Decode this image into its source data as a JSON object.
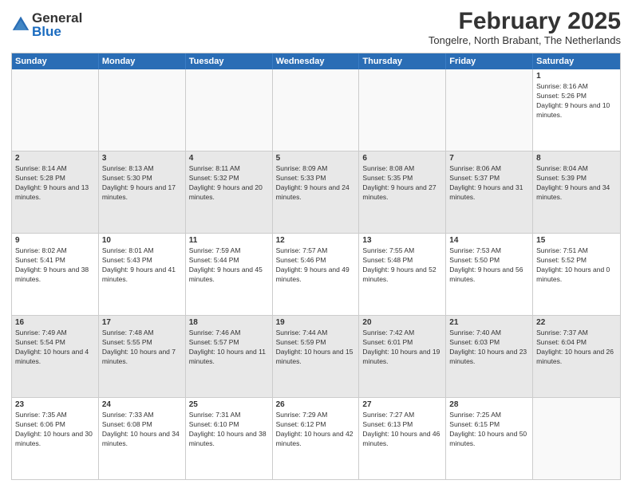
{
  "logo": {
    "general": "General",
    "blue": "Blue"
  },
  "title": "February 2025",
  "location": "Tongelre, North Brabant, The Netherlands",
  "header_days": [
    "Sunday",
    "Monday",
    "Tuesday",
    "Wednesday",
    "Thursday",
    "Friday",
    "Saturday"
  ],
  "weeks": [
    [
      {
        "day": "",
        "info": ""
      },
      {
        "day": "",
        "info": ""
      },
      {
        "day": "",
        "info": ""
      },
      {
        "day": "",
        "info": ""
      },
      {
        "day": "",
        "info": ""
      },
      {
        "day": "",
        "info": ""
      },
      {
        "day": "1",
        "info": "Sunrise: 8:16 AM\nSunset: 5:26 PM\nDaylight: 9 hours and 10 minutes."
      }
    ],
    [
      {
        "day": "2",
        "info": "Sunrise: 8:14 AM\nSunset: 5:28 PM\nDaylight: 9 hours and 13 minutes."
      },
      {
        "day": "3",
        "info": "Sunrise: 8:13 AM\nSunset: 5:30 PM\nDaylight: 9 hours and 17 minutes."
      },
      {
        "day": "4",
        "info": "Sunrise: 8:11 AM\nSunset: 5:32 PM\nDaylight: 9 hours and 20 minutes."
      },
      {
        "day": "5",
        "info": "Sunrise: 8:09 AM\nSunset: 5:33 PM\nDaylight: 9 hours and 24 minutes."
      },
      {
        "day": "6",
        "info": "Sunrise: 8:08 AM\nSunset: 5:35 PM\nDaylight: 9 hours and 27 minutes."
      },
      {
        "day": "7",
        "info": "Sunrise: 8:06 AM\nSunset: 5:37 PM\nDaylight: 9 hours and 31 minutes."
      },
      {
        "day": "8",
        "info": "Sunrise: 8:04 AM\nSunset: 5:39 PM\nDaylight: 9 hours and 34 minutes."
      }
    ],
    [
      {
        "day": "9",
        "info": "Sunrise: 8:02 AM\nSunset: 5:41 PM\nDaylight: 9 hours and 38 minutes."
      },
      {
        "day": "10",
        "info": "Sunrise: 8:01 AM\nSunset: 5:43 PM\nDaylight: 9 hours and 41 minutes."
      },
      {
        "day": "11",
        "info": "Sunrise: 7:59 AM\nSunset: 5:44 PM\nDaylight: 9 hours and 45 minutes."
      },
      {
        "day": "12",
        "info": "Sunrise: 7:57 AM\nSunset: 5:46 PM\nDaylight: 9 hours and 49 minutes."
      },
      {
        "day": "13",
        "info": "Sunrise: 7:55 AM\nSunset: 5:48 PM\nDaylight: 9 hours and 52 minutes."
      },
      {
        "day": "14",
        "info": "Sunrise: 7:53 AM\nSunset: 5:50 PM\nDaylight: 9 hours and 56 minutes."
      },
      {
        "day": "15",
        "info": "Sunrise: 7:51 AM\nSunset: 5:52 PM\nDaylight: 10 hours and 0 minutes."
      }
    ],
    [
      {
        "day": "16",
        "info": "Sunrise: 7:49 AM\nSunset: 5:54 PM\nDaylight: 10 hours and 4 minutes."
      },
      {
        "day": "17",
        "info": "Sunrise: 7:48 AM\nSunset: 5:55 PM\nDaylight: 10 hours and 7 minutes."
      },
      {
        "day": "18",
        "info": "Sunrise: 7:46 AM\nSunset: 5:57 PM\nDaylight: 10 hours and 11 minutes."
      },
      {
        "day": "19",
        "info": "Sunrise: 7:44 AM\nSunset: 5:59 PM\nDaylight: 10 hours and 15 minutes."
      },
      {
        "day": "20",
        "info": "Sunrise: 7:42 AM\nSunset: 6:01 PM\nDaylight: 10 hours and 19 minutes."
      },
      {
        "day": "21",
        "info": "Sunrise: 7:40 AM\nSunset: 6:03 PM\nDaylight: 10 hours and 23 minutes."
      },
      {
        "day": "22",
        "info": "Sunrise: 7:37 AM\nSunset: 6:04 PM\nDaylight: 10 hours and 26 minutes."
      }
    ],
    [
      {
        "day": "23",
        "info": "Sunrise: 7:35 AM\nSunset: 6:06 PM\nDaylight: 10 hours and 30 minutes."
      },
      {
        "day": "24",
        "info": "Sunrise: 7:33 AM\nSunset: 6:08 PM\nDaylight: 10 hours and 34 minutes."
      },
      {
        "day": "25",
        "info": "Sunrise: 7:31 AM\nSunset: 6:10 PM\nDaylight: 10 hours and 38 minutes."
      },
      {
        "day": "26",
        "info": "Sunrise: 7:29 AM\nSunset: 6:12 PM\nDaylight: 10 hours and 42 minutes."
      },
      {
        "day": "27",
        "info": "Sunrise: 7:27 AM\nSunset: 6:13 PM\nDaylight: 10 hours and 46 minutes."
      },
      {
        "day": "28",
        "info": "Sunrise: 7:25 AM\nSunset: 6:15 PM\nDaylight: 10 hours and 50 minutes."
      },
      {
        "day": "",
        "info": ""
      }
    ]
  ]
}
